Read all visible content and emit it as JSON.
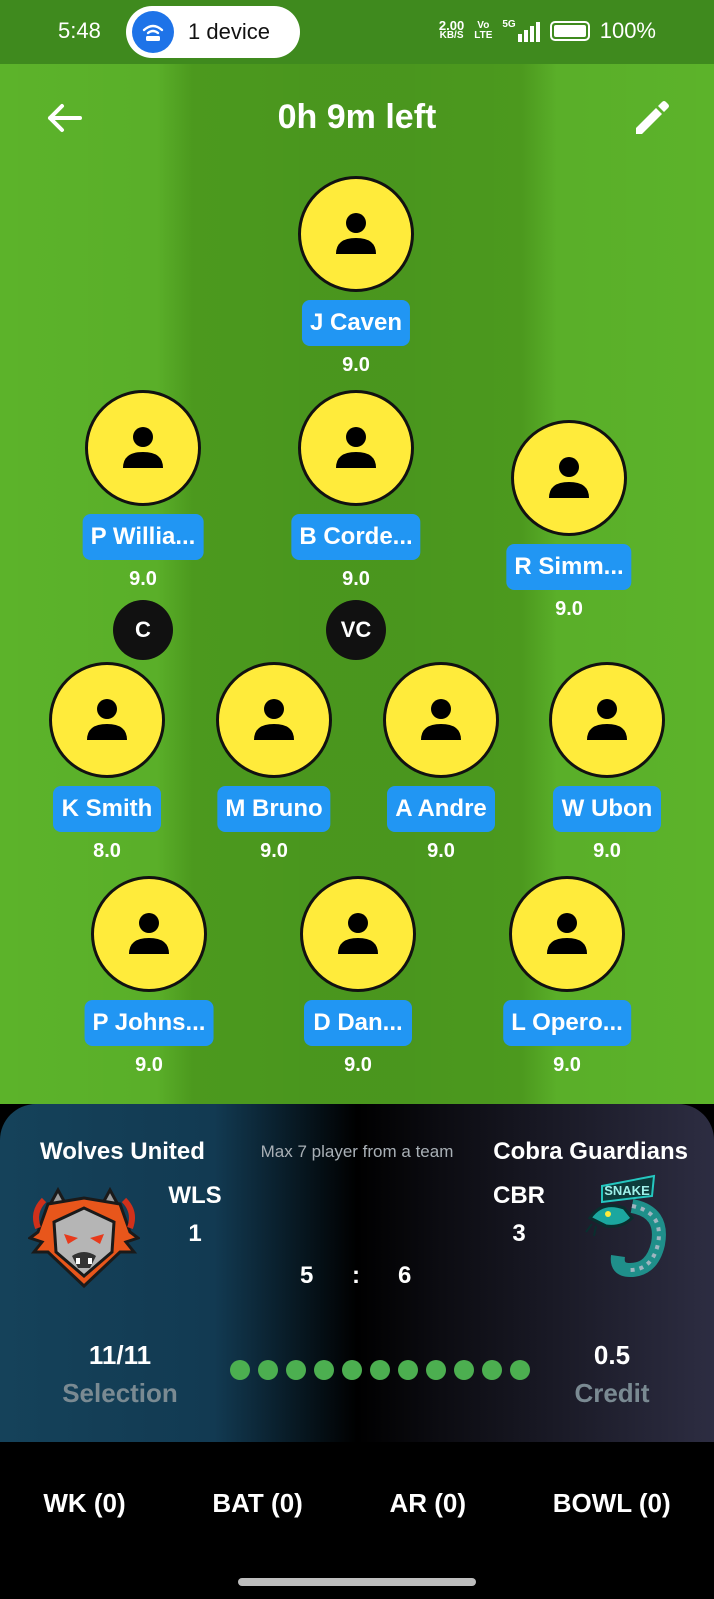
{
  "status_bar": {
    "time": "5:48",
    "pill_label": "1 device",
    "net_speed_top": "2.00",
    "net_speed_bottom": "KB/S",
    "volte_top": "Vo",
    "volte_bottom": "LTE",
    "signal_label": "5G",
    "battery": "100%"
  },
  "header": {
    "title": "0h 9m left"
  },
  "players": [
    {
      "name": "J Caven",
      "credit": "9.0"
    },
    {
      "name": "P Willia...",
      "credit": "9.0"
    },
    {
      "name": "B Corde...",
      "credit": "9.0"
    },
    {
      "name": "R Simm...",
      "credit": "9.0"
    },
    {
      "name": "K Smith",
      "credit": "8.0"
    },
    {
      "name": "M Bruno",
      "credit": "9.0"
    },
    {
      "name": "A Andre",
      "credit": "9.0"
    },
    {
      "name": "W Ubon",
      "credit": "9.0"
    },
    {
      "name": "P Johns...",
      "credit": "9.0"
    },
    {
      "name": "D Dan...",
      "credit": "9.0"
    },
    {
      "name": "L Opero...",
      "credit": "9.0"
    }
  ],
  "badges": {
    "captain": "C",
    "vice_captain": "VC"
  },
  "panel": {
    "team1_name": "Wolves United",
    "team2_name": "Cobra Guardians",
    "max_note": "Max 7 player from a team",
    "team1_code": "WLS",
    "team1_count": "1",
    "team2_code": "CBR",
    "team2_count": "3",
    "score_left": "5",
    "score_sep": ":",
    "score_right": "6",
    "selection_value": "11/11",
    "selection_label": "Selection",
    "credit_value": "0.5",
    "credit_label": "Credit",
    "selected_dots": 11,
    "team2_logo_text": "SNAKE"
  },
  "tabs": [
    {
      "label": "WK (0)"
    },
    {
      "label": "BAT (0)"
    },
    {
      "label": "AR (0)"
    },
    {
      "label": "BOWL (0)"
    }
  ],
  "colors": {
    "field": "#5cb32a",
    "avatar": "#ffeb3b",
    "name_tag": "#2196f3",
    "dot": "#4caf50"
  }
}
